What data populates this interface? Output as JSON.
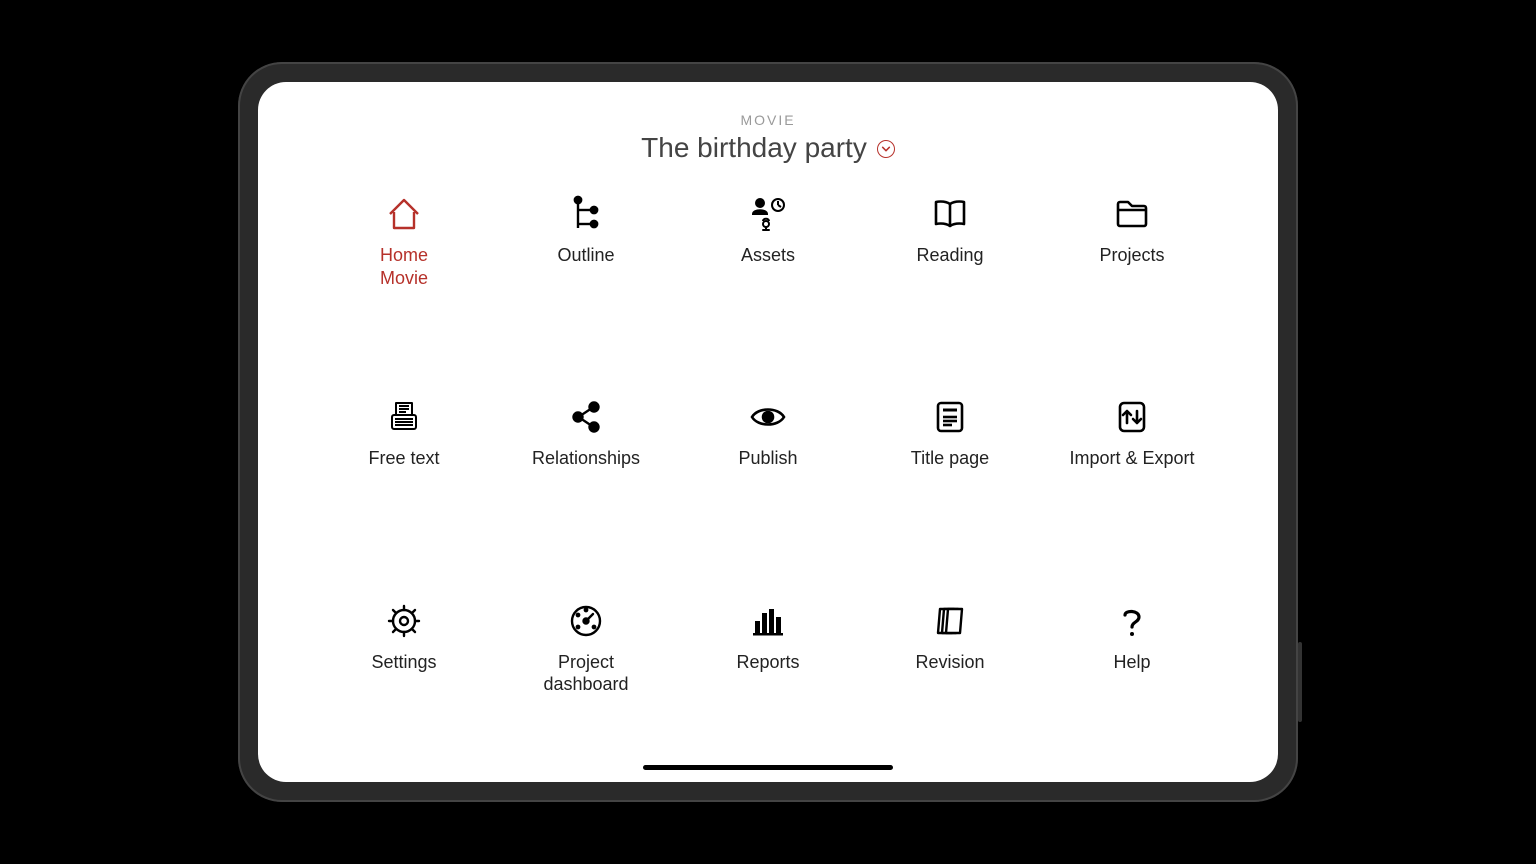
{
  "header": {
    "kicker": "MOVIE",
    "title": "The birthday party"
  },
  "accent_color": "#b6312a",
  "tiles": [
    {
      "label": "Home",
      "label2": "Movie",
      "icon": "home-icon",
      "active": true
    },
    {
      "label": "Outline",
      "icon": "outline-icon"
    },
    {
      "label": "Assets",
      "icon": "assets-icon"
    },
    {
      "label": "Reading",
      "icon": "reading-icon"
    },
    {
      "label": "Projects",
      "icon": "projects-icon"
    },
    {
      "label": "Free text",
      "icon": "typewriter-icon"
    },
    {
      "label": "Relationships",
      "icon": "share-icon"
    },
    {
      "label": "Publish",
      "icon": "eye-icon"
    },
    {
      "label": "Title page",
      "icon": "titlepage-icon"
    },
    {
      "label": "Import & Export",
      "icon": "import-export-icon"
    },
    {
      "label": "Settings",
      "icon": "gear-icon"
    },
    {
      "label": "Project\ndashboard",
      "icon": "gauge-icon"
    },
    {
      "label": "Reports",
      "icon": "bars-icon"
    },
    {
      "label": "Revision",
      "icon": "pages-icon"
    },
    {
      "label": "Help",
      "icon": "question-icon"
    }
  ]
}
